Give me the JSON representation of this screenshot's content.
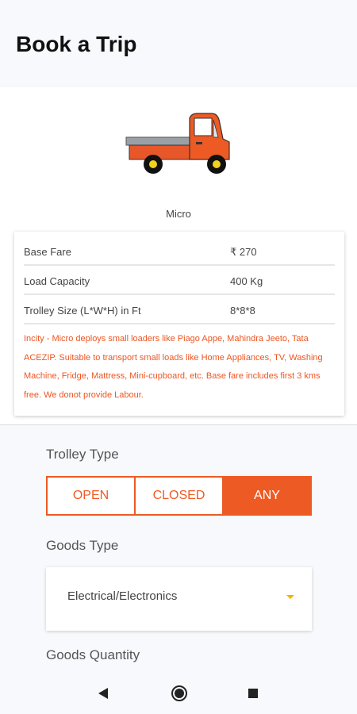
{
  "header": {
    "title": "Book a Trip"
  },
  "vehicle": {
    "icon": "loader-truck-icon",
    "name": "Micro"
  },
  "fare_card": {
    "rows": [
      {
        "label": "Base Fare",
        "value": "₹ 270"
      },
      {
        "label": "Load Capacity",
        "value": "400 Kg"
      },
      {
        "label": "Trolley Size (L*W*H) in Ft",
        "value": "8*8*8"
      }
    ],
    "note": "Incity - Micro deploys small loaders like Piago Appe, Mahindra Jeeto, Tata ACEZIP. Suitable to transport small loads like Home Appliances, TV, Washing Machine, Fridge, Mattress, Mini-cupboard, etc. Base fare includes first 3 kms free. We donot provide Labour."
  },
  "trolley_type": {
    "label": "Trolley Type",
    "options": [
      "OPEN",
      "CLOSED",
      "ANY"
    ],
    "selected": "ANY"
  },
  "goods_type": {
    "label": "Goods Type",
    "selected": "Electrical/Electronics"
  },
  "goods_quantity": {
    "label": "Goods Quantity"
  },
  "colors": {
    "accent": "#ee5a24",
    "note": "#ee5522",
    "dropdown_arrow": "#f2b200"
  },
  "navbar": {
    "icons": [
      "back-icon",
      "home-icon",
      "recent-apps-icon"
    ]
  }
}
